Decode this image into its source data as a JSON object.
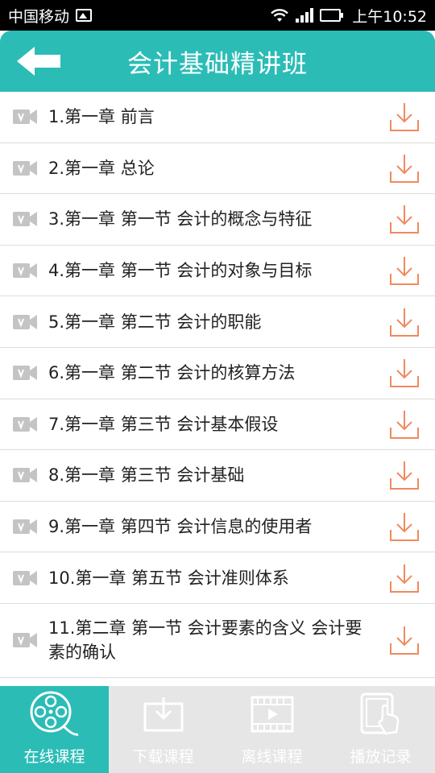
{
  "status_bar": {
    "carrier": "中国移动",
    "time": "上午10:52"
  },
  "header": {
    "title": "会计基础精讲班"
  },
  "lessons": [
    {
      "title": "1.第一章 前言"
    },
    {
      "title": "2.第一章 总论"
    },
    {
      "title": "3.第一章 第一节 会计的概念与特征"
    },
    {
      "title": "4.第一章 第一节 会计的对象与目标"
    },
    {
      "title": "5.第一章 第二节 会计的职能"
    },
    {
      "title": "6.第一章 第二节 会计的核算方法"
    },
    {
      "title": "7.第一章 第三节 会计基本假设"
    },
    {
      "title": "8.第一章 第三节 会计基础"
    },
    {
      "title": "9.第一章 第四节 会计信息的使用者"
    },
    {
      "title": "10.第一章 第五节 会计准则体系"
    },
    {
      "title": "11.第二章 第一节 会计要素的含义 会计要素的确认"
    }
  ],
  "tabs": [
    {
      "label": "在线课程",
      "icon": "film-reel-icon",
      "active": true
    },
    {
      "label": "下载课程",
      "icon": "download-tray-icon",
      "active": false
    },
    {
      "label": "离线课程",
      "icon": "film-strip-icon",
      "active": false
    },
    {
      "label": "播放记录",
      "icon": "tablet-touch-icon",
      "active": false
    }
  ],
  "colors": {
    "accent": "#2bbcb6",
    "download": "#f08a5d",
    "video_icon": "#c4c4c4",
    "tab_bar": "#e6e6e6"
  }
}
